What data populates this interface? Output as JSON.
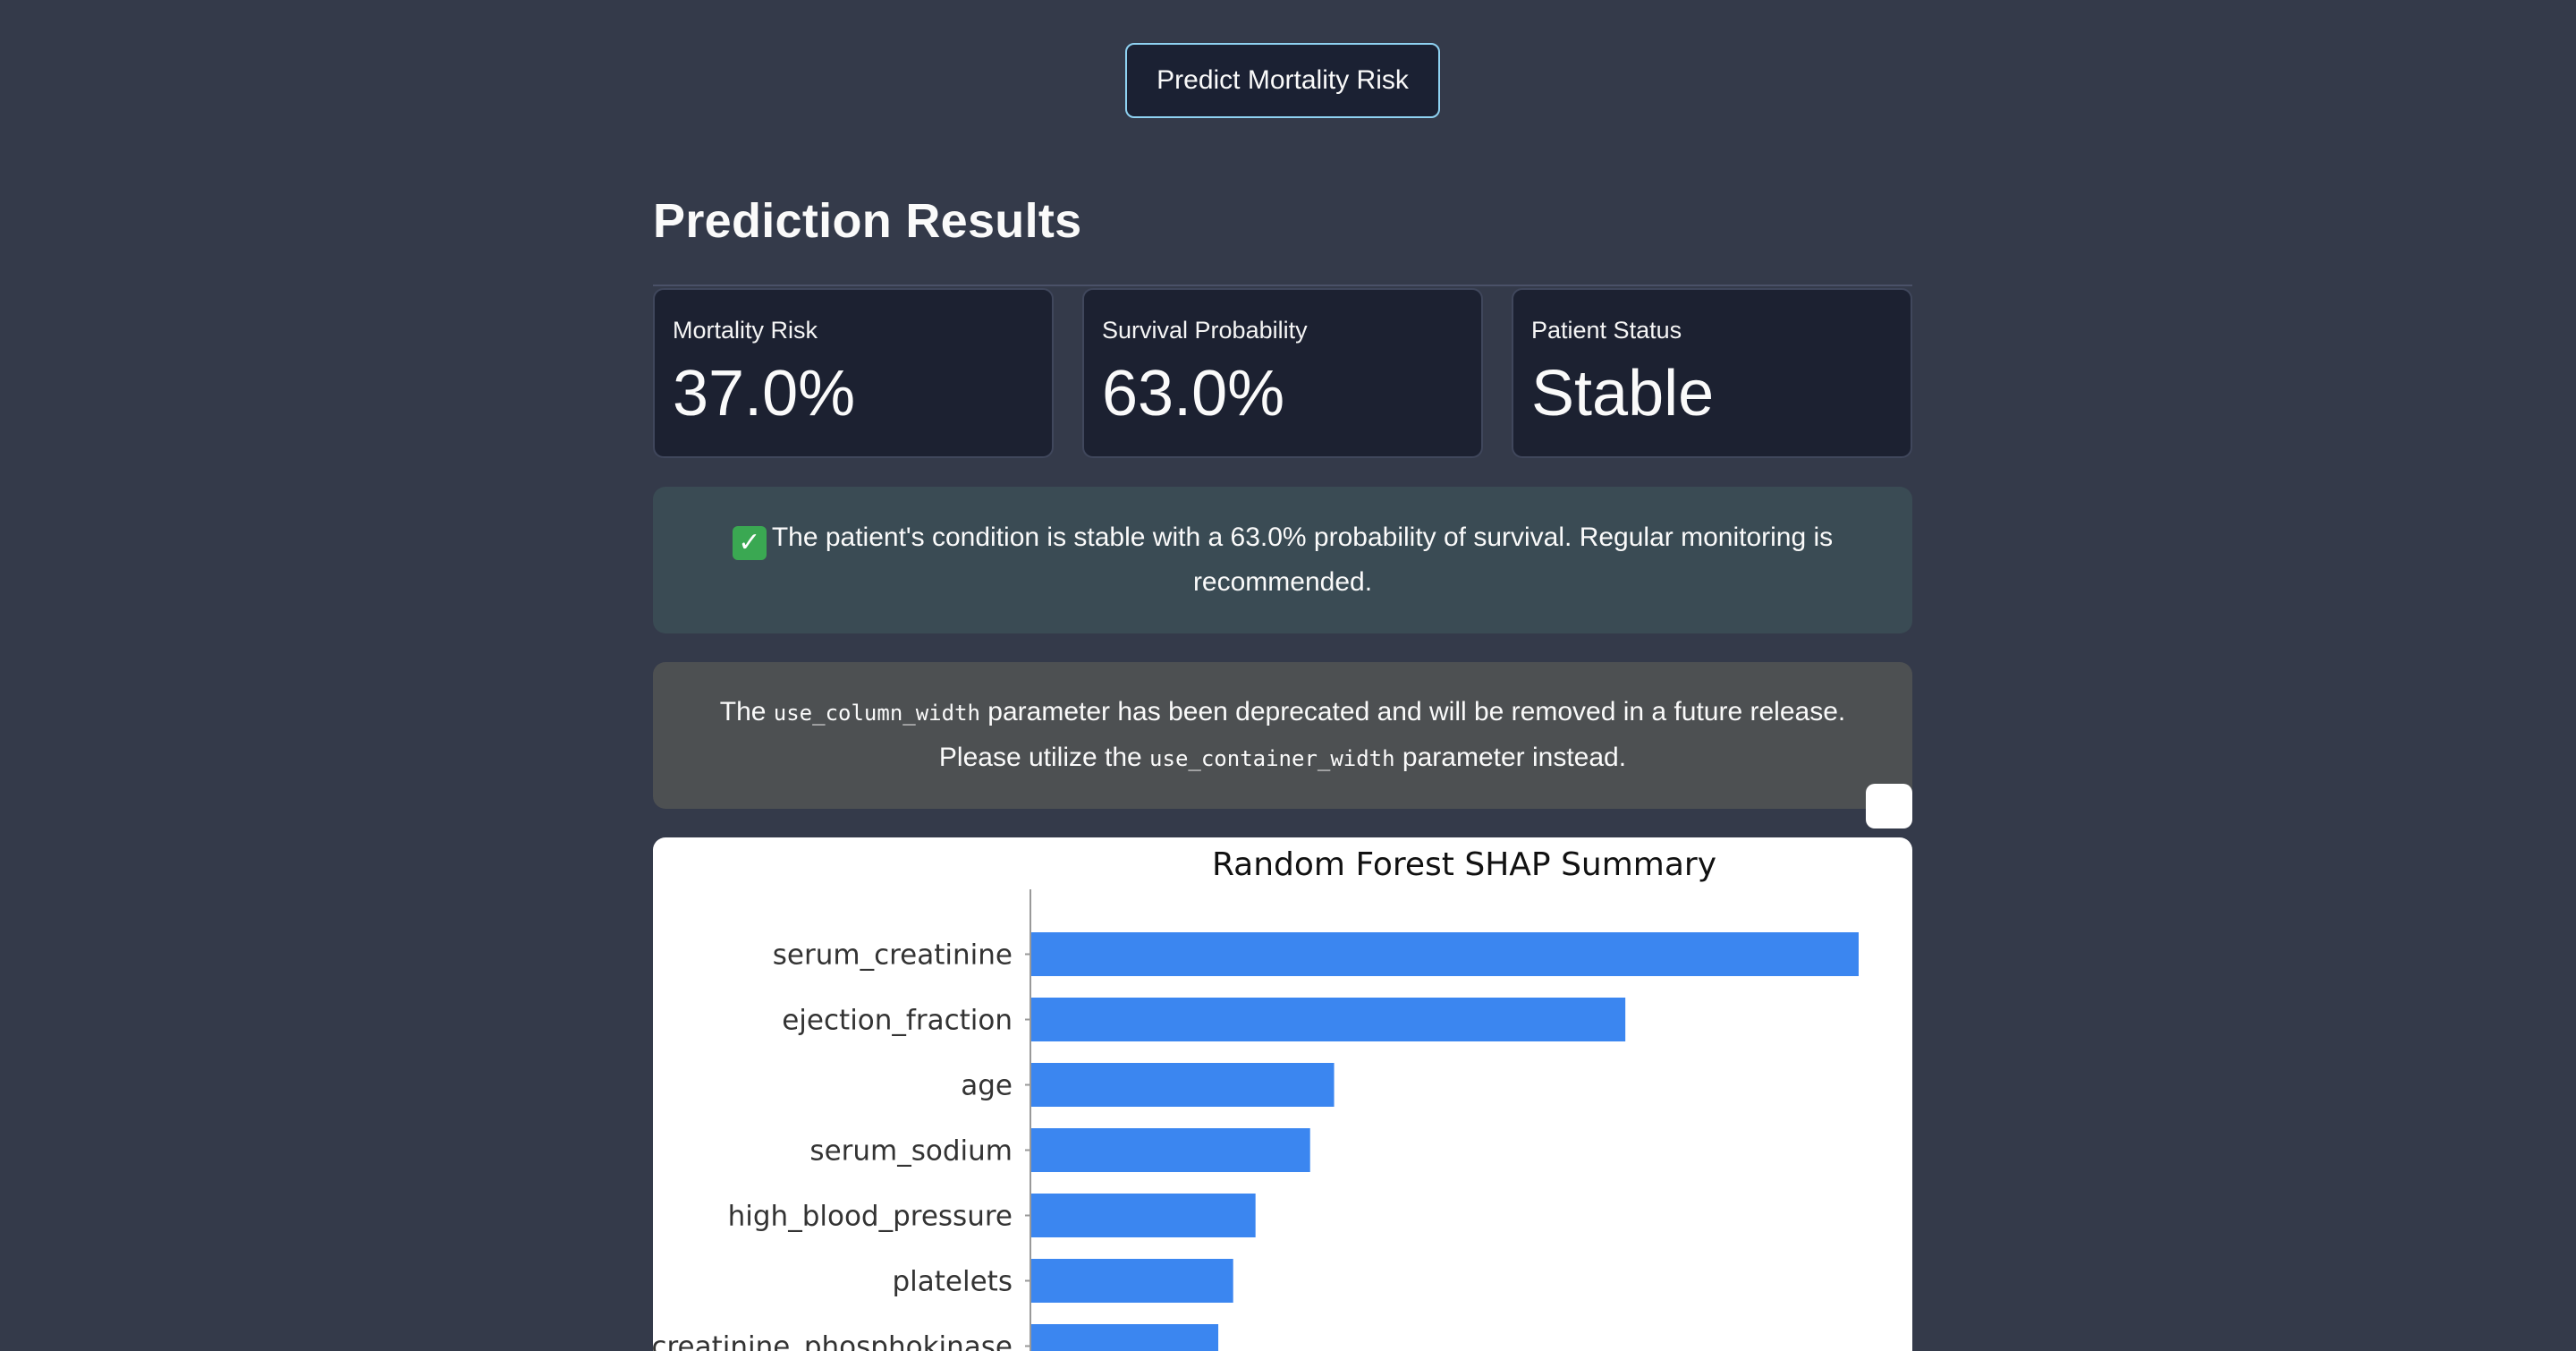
{
  "predict_button": {
    "label": "Predict Mortality Risk"
  },
  "results": {
    "title": "Prediction Results",
    "metrics": [
      {
        "label": "Mortality Risk",
        "value": "37.0%"
      },
      {
        "label": "Survival Probability",
        "value": "63.0%"
      },
      {
        "label": "Patient Status",
        "value": "Stable"
      }
    ]
  },
  "success_alert": {
    "icon": "check-mark-button-icon",
    "text": "The patient's condition is stable with a 63.0% probability of survival. Regular monitoring is recommended."
  },
  "deprecation_alert": {
    "text_1": "The ",
    "code_1": "use_column_width",
    "text_2": " parameter has been deprecated and will be removed in a future release. Please utilize the ",
    "code_2": "use_container_width",
    "text_3": " parameter instead."
  },
  "colors": {
    "background": "#343a4a",
    "bar": "#3b86f0",
    "button_border": "#8fd2f2"
  },
  "chart_data": {
    "type": "bar",
    "orientation": "horizontal",
    "title": "Random Forest SHAP Summary",
    "categories": [
      "serum_creatinine",
      "ejection_fraction",
      "age",
      "serum_sodium",
      "high_blood_pressure",
      "platelets",
      "creatinine_phosphokinase"
    ],
    "values": [
      1.0,
      0.718,
      0.366,
      0.337,
      0.271,
      0.244,
      0.226
    ],
    "xlim": [
      0,
      1.0
    ],
    "grid": false
  }
}
